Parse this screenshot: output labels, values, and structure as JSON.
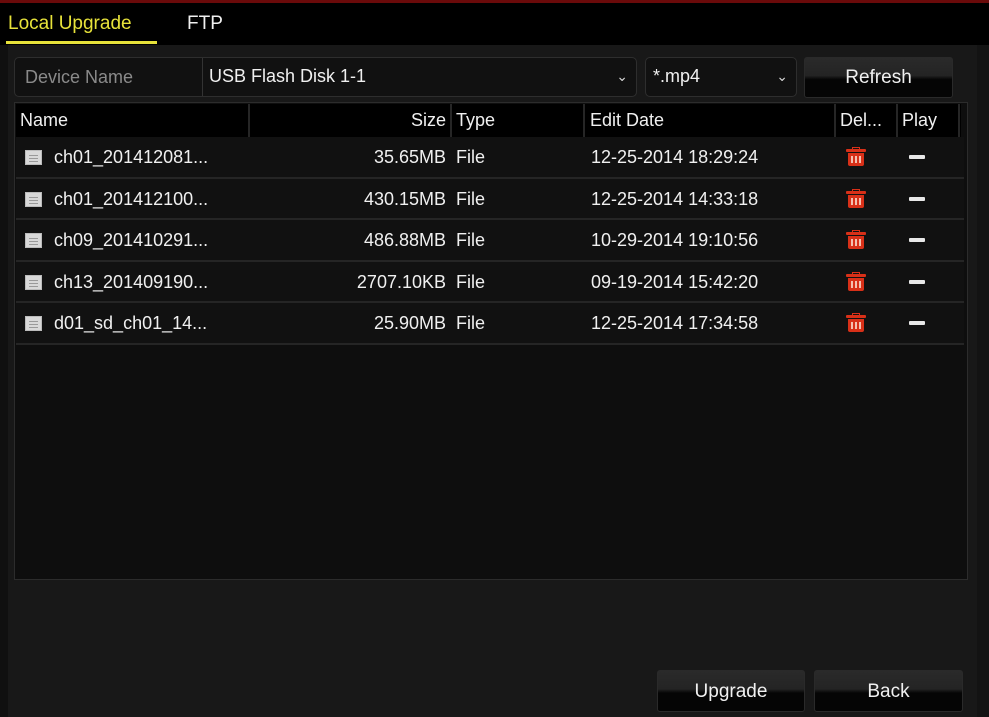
{
  "tabs": [
    {
      "label": "Local Upgrade",
      "active": true
    },
    {
      "label": "FTP",
      "active": false
    }
  ],
  "device": {
    "label": "Device Name",
    "value": "USB Flash Disk 1-1"
  },
  "filter": {
    "value": "*.mp4"
  },
  "toolbar": {
    "refresh_label": "Refresh"
  },
  "table": {
    "columns": [
      "Name",
      "Size",
      "Type",
      "Edit Date",
      "Del...",
      "Play"
    ],
    "rows": [
      {
        "icon": "file-icon",
        "name": "ch01_201412081...",
        "size": "35.65MB",
        "type": "File",
        "edit_date": "12-25-2014 18:29:24"
      },
      {
        "icon": "file-icon",
        "name": "ch01_201412100...",
        "size": "430.15MB",
        "type": "File",
        "edit_date": "12-25-2014 14:33:18"
      },
      {
        "icon": "file-icon",
        "name": "ch09_201410291...",
        "size": "486.88MB",
        "type": "File",
        "edit_date": "10-29-2014 19:10:56"
      },
      {
        "icon": "file-icon",
        "name": "ch13_201409190...",
        "size": "2707.10KB",
        "type": "File",
        "edit_date": "09-19-2014 15:42:20"
      },
      {
        "icon": "file-icon",
        "name": "d01_sd_ch01_14...",
        "size": "25.90MB",
        "type": "File",
        "edit_date": "12-25-2014 17:34:58"
      }
    ]
  },
  "footer": {
    "upgrade_label": "Upgrade",
    "back_label": "Back"
  },
  "colors": {
    "active_tab": "#e7e23a",
    "delete_icon": "#d83018",
    "background": "#181818"
  }
}
